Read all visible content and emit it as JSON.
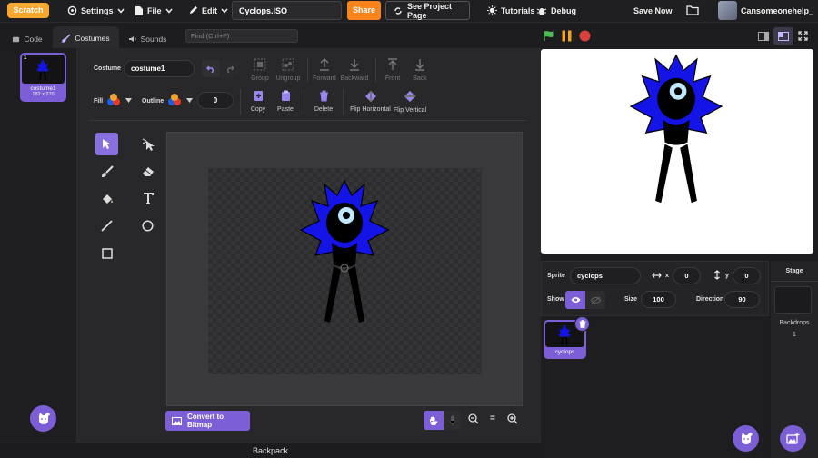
{
  "menubar": {
    "logo": "Scratch",
    "settings": "Settings",
    "file": "File",
    "edit": "Edit",
    "project_title": "Cyclops.ISO",
    "share": "Share",
    "see_project_page": "See Project Page",
    "tutorials": "Tutorials",
    "debug": "Debug",
    "save_now": "Save Now",
    "username": "Cansomeonehelp_"
  },
  "tabs": {
    "code": "Code",
    "costumes": "Costumes",
    "sounds": "Sounds",
    "find_placeholder": "Find (Ctrl+F)"
  },
  "costume_list": {
    "items": [
      {
        "number": "1",
        "name": "costume1",
        "size": "182 x 270"
      }
    ]
  },
  "paint": {
    "costume_label": "Costume",
    "costume_name": "costume1",
    "group": "Group",
    "ungroup": "Ungroup",
    "forward": "Forward",
    "backward": "Backward",
    "front": "Front",
    "back": "Back",
    "fill_label": "Fill",
    "outline_label": "Outline",
    "outline_width": "0",
    "copy": "Copy",
    "paste": "Paste",
    "delete": "Delete",
    "flip_horizontal": "Flip Horizontal",
    "flip_vertical": "Flip Vertical",
    "convert_to_bitmap": "Convert to Bitmap",
    "zoom_reset": "="
  },
  "backpack": "Backpack",
  "sprite_info": {
    "sprite_label": "Sprite",
    "sprite_name": "cyclops",
    "x_label": "x",
    "x_value": "0",
    "y_label": "y",
    "y_value": "0",
    "show_label": "Show",
    "size_label": "Size",
    "size_value": "100",
    "direction_label": "Direction",
    "direction_value": "90"
  },
  "sprites": [
    {
      "name": "cyclops"
    }
  ],
  "stage_panel": {
    "stage_label": "Stage",
    "backdrops_label": "Backdrops",
    "backdrops_count": "1"
  },
  "colors": {
    "accent": "#7c5fd6",
    "share": "#f7841e",
    "logo": "#f7a72d",
    "character_blue": "#1414e6"
  }
}
